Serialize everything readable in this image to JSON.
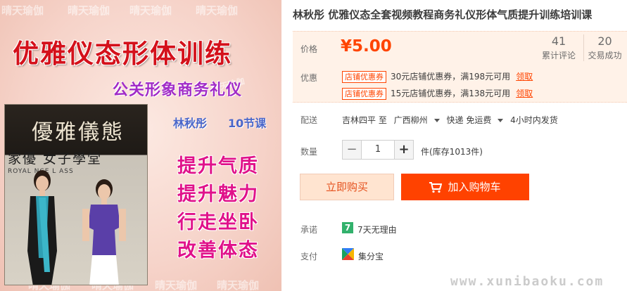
{
  "image": {
    "watermark": "晴天瑜伽",
    "title": "优雅仪态形体训练",
    "subtitle": "公关形象商务礼仪",
    "author": "林秋彤",
    "lessons": "10节课",
    "photo_sign_top": "優雅儀態",
    "photo_sign_mid": "家優  女子學堂",
    "photo_sign_bottom": "ROYAL      NCE L      ASS",
    "benefits": [
      "提升气质",
      "提升魅力",
      "行走坐卧",
      "改善体态"
    ]
  },
  "product": {
    "title": "林秋彤 优雅仪态全套视频教程商务礼仪形体气质提升训练培训课"
  },
  "price": {
    "label": "价格",
    "value": "¥5.00",
    "review_count": "41",
    "review_label": "累计评论",
    "sold_count": "20",
    "sold_label": "交易成功"
  },
  "promo": {
    "label": "优惠",
    "coupons": [
      {
        "tag": "店铺优惠券",
        "text": "30元店铺优惠券，满198元可用",
        "action": "领取"
      },
      {
        "tag": "店铺优惠券",
        "text": "15元店铺优惠券，满138元可用",
        "action": "领取"
      }
    ]
  },
  "shipping": {
    "label": "配送",
    "from": "吉林四平 至",
    "to": "广西柳州",
    "method": "快递 免运费",
    "dispatch": "4小时内发货"
  },
  "quantity": {
    "label": "数量",
    "minus": "−",
    "value": "1",
    "plus": "+",
    "stock": "件(库存1013件)"
  },
  "actions": {
    "buy_now": "立即购买",
    "add_to_cart": "加入购物车"
  },
  "promise": {
    "label": "承诺",
    "icon_text": "7",
    "text": "7天无理由"
  },
  "payment": {
    "label": "支付",
    "text": "集分宝"
  },
  "site_watermark": "www.xunibaoku.com",
  "colors": {
    "accent": "#ff4400",
    "cart_button": "#ff4200",
    "buy_button_bg": "#ffe4d0",
    "price_bg": "#fff2e8",
    "promise_green": "#32b16c"
  }
}
